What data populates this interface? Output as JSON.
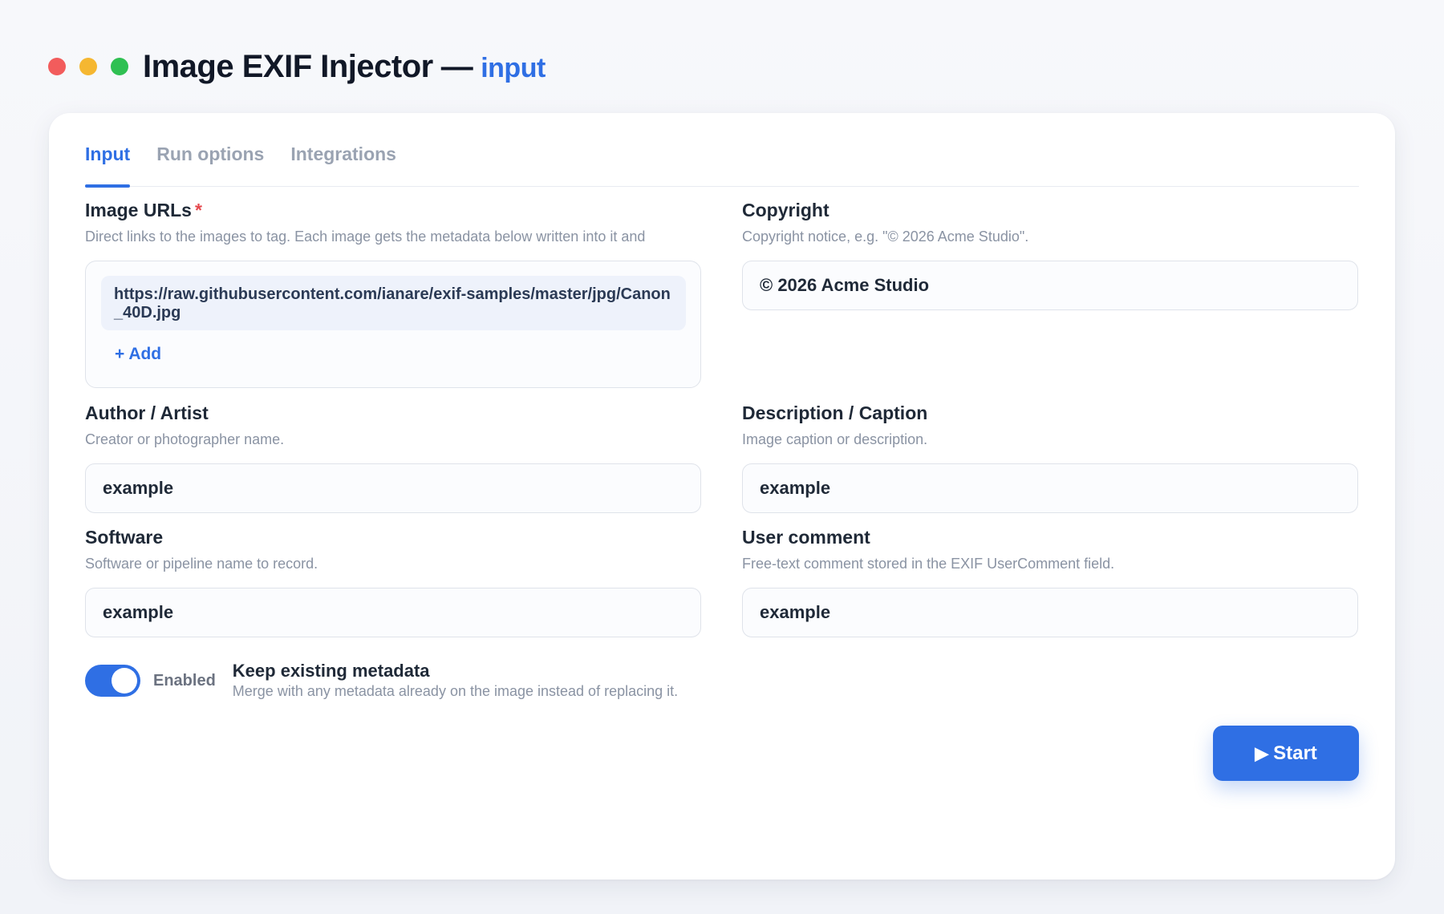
{
  "window": {
    "title": "Image EXIF Injector",
    "separator": "—",
    "subtitle": "input"
  },
  "tabs": [
    {
      "label": "Input",
      "active": true
    },
    {
      "label": "Run options",
      "active": false
    },
    {
      "label": "Integrations",
      "active": false
    }
  ],
  "fields": {
    "image_urls": {
      "label": "Image URLs",
      "required_mark": "*",
      "help": "Direct links to the images to tag. Each image gets the metadata below written into it and",
      "items": [
        "https://raw.githubusercontent.com/ianare/exif-samples/master/jpg/Canon_40D.jpg"
      ],
      "add_label": "+ Add"
    },
    "copyright": {
      "label": "Copyright",
      "help": "Copyright notice, e.g. \"© 2026 Acme Studio\".",
      "value": "© 2026 Acme Studio"
    },
    "author": {
      "label": "Author / Artist",
      "help": "Creator or photographer name.",
      "value": "example"
    },
    "description": {
      "label": "Description / Caption",
      "help": "Image caption or description.",
      "value": "example"
    },
    "software": {
      "label": "Software",
      "help": "Software or pipeline name to record.",
      "value": "example"
    },
    "user_comment": {
      "label": "User comment",
      "help": "Free-text comment stored in the EXIF UserComment field.",
      "value": "example"
    }
  },
  "keep_metadata": {
    "state_label": "Enabled",
    "enabled": true,
    "title": "Keep existing metadata",
    "help": "Merge with any metadata already on the image instead of replacing it."
  },
  "start_button": {
    "icon": "▶",
    "label": "Start"
  },
  "colors": {
    "accent": "#2f6fe4",
    "required": "#e5484d",
    "traffic_red": "#f25c5c",
    "traffic_yellow": "#f5b731",
    "traffic_green": "#2fc052"
  }
}
